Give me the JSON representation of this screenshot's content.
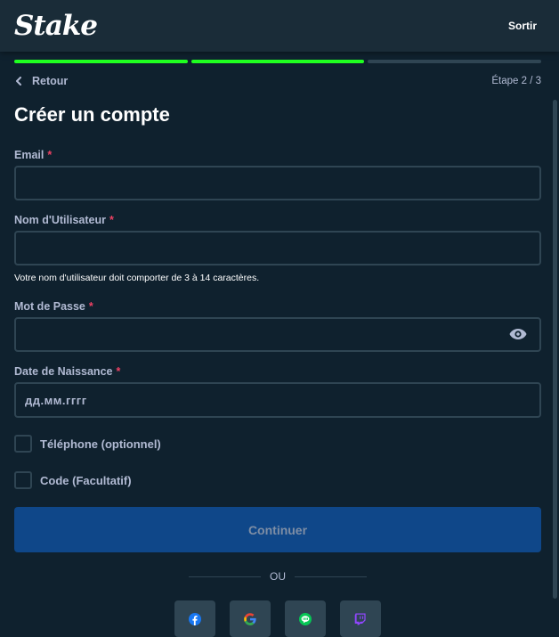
{
  "header": {
    "logo_text": "Stake",
    "exit_label": "Sortir"
  },
  "progress": {
    "total_steps": 3,
    "completed_steps": 2,
    "active_color": "#1fff20",
    "inactive_color": "#2f4553"
  },
  "nav": {
    "back_label": "Retour",
    "step_label": "Étape 2 / 3"
  },
  "form": {
    "title": "Créer un compte",
    "required_mark": "*",
    "email": {
      "label": "Email",
      "value": ""
    },
    "username": {
      "label": "Nom d'Utilisateur",
      "value": "",
      "hint": "Votre nom d'utilisateur doit comporter de 3 à 14 caractères."
    },
    "password": {
      "label": "Mot de Passe",
      "value": ""
    },
    "birthdate": {
      "label": "Date de Naissance",
      "placeholder": "дд.мм.гггг",
      "value": ""
    },
    "phone_option": {
      "label": "Téléphone (optionnel)",
      "checked": false
    },
    "code_option": {
      "label": "Code (Facultatif)",
      "checked": false
    },
    "continue_label": "Continuer"
  },
  "social": {
    "divider_text": "OU",
    "providers": [
      "facebook-icon",
      "google-icon",
      "line-icon",
      "twitch-icon"
    ]
  },
  "colors": {
    "background": "#0f212e",
    "header": "#1a2c38",
    "border": "#2f4553",
    "button": "#0f4789",
    "required": "#ed4163"
  }
}
